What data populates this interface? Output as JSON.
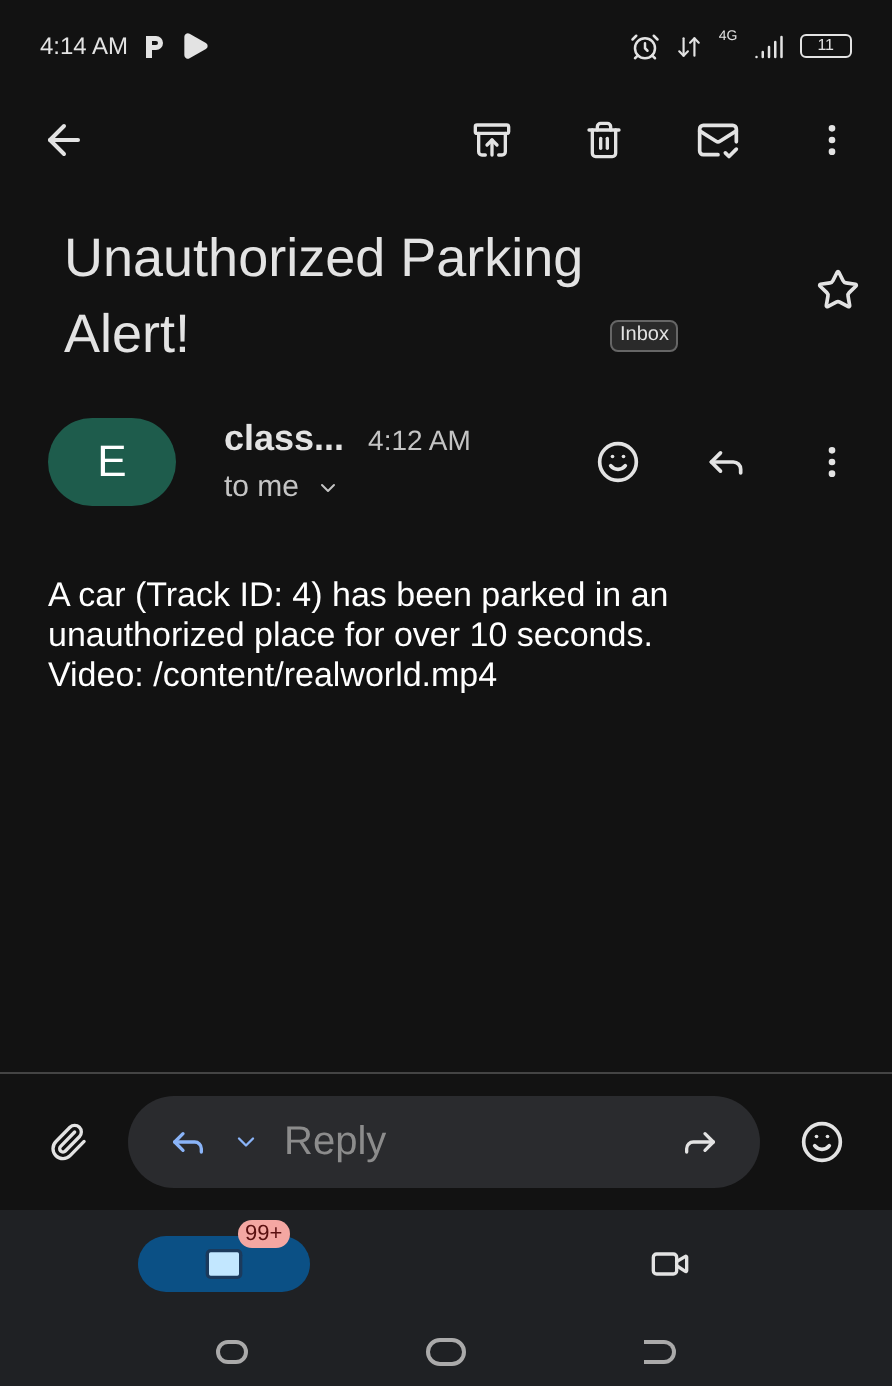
{
  "status_bar": {
    "time": "4:14 AM",
    "network": "4G",
    "battery": "11"
  },
  "subject": {
    "title": "Unauthorized Parking Alert!",
    "label": "Inbox",
    "starred": false
  },
  "message": {
    "avatar_letter": "E",
    "sender": "class...",
    "time": "4:12 AM",
    "recipient": "to me",
    "body": [
      "A car (Track ID: 4) has been parked in an unauthorized place for over 10 seconds.",
      "Video: /content/realworld.mp4"
    ]
  },
  "reply_bar": {
    "placeholder": "Reply"
  },
  "bottom_nav": [
    {
      "kind": "mail",
      "selected": true,
      "badge": "99+"
    },
    {
      "kind": "video",
      "selected": false
    }
  ]
}
